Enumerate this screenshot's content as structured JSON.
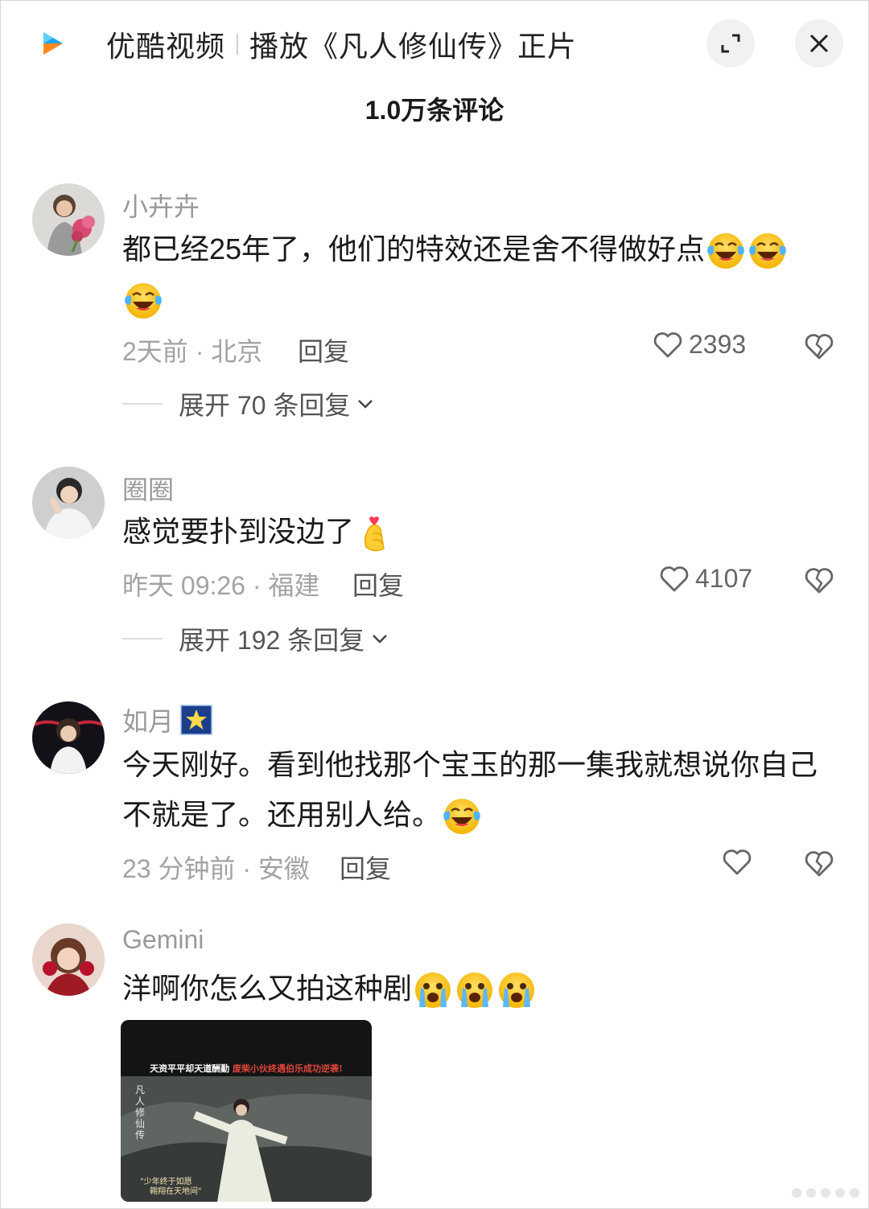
{
  "header": {
    "app_name": "优酷视频",
    "playing_label": "播放《凡人修仙传》正片"
  },
  "comment_count": "1.0万条评论",
  "comments": [
    {
      "username": "小卉卉",
      "text": "都已经25年了，他们的特效还是舍不得做好点",
      "emojis": [
        "laugh-cry-emoji",
        "laugh-cry-emoji",
        "laugh-cry-emoji"
      ],
      "meta": "2天前 · 北京",
      "reply_label": "回复",
      "likes": "2393",
      "expand_label": "展开 70 条回复"
    },
    {
      "username": "圈圈",
      "text": "感觉要扑到没边了",
      "emojis": [
        "finger-heart-emoji"
      ],
      "meta": "昨天 09:26 · 福建",
      "reply_label": "回复",
      "likes": "4107",
      "expand_label": "展开 192 条回复"
    },
    {
      "username": "如月",
      "username_badge": "star-badge",
      "text_line1": "今天刚好。看到他找那个宝玉的那一集我就想说你自己",
      "text_line2": "不就是了。还用别人给。",
      "emojis": [
        "laugh-cry-emoji"
      ],
      "meta": "23 分钟前 · 安徽",
      "reply_label": "回复",
      "likes": ""
    },
    {
      "username": "Gemini",
      "text": "洋啊你怎么又拍这种剧",
      "emojis": [
        "crying-emoji",
        "crying-emoji",
        "crying-emoji"
      ],
      "video": {
        "banner_white": "天资平平却天道酬勤",
        "banner_red": "废柴小伙终遇伯乐成功逆袭!",
        "logo_text": "凡人修仙传",
        "caption_line1": "\"少年终于如愿",
        "caption_line2": "翱翔在天地间\""
      }
    }
  ],
  "colors": {
    "accent_logo": "#1ea4ff",
    "accent_logo_secondary": "#ff8a1f",
    "meta_gray": "#a3a3a3",
    "username_gray": "#9a9a9a"
  }
}
